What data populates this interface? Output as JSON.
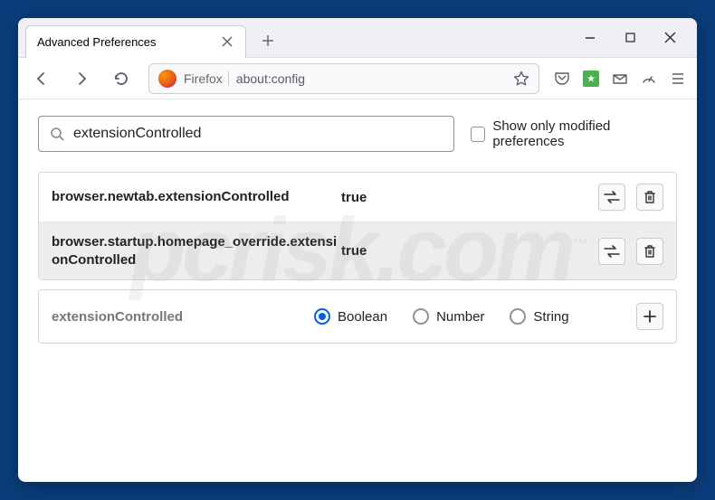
{
  "titlebar": {
    "tab_title": "Advanced Preferences"
  },
  "toolbar": {
    "identity_label": "Firefox",
    "url": "about:config"
  },
  "search": {
    "value": "extensionControlled",
    "show_modified_label": "Show only modified preferences"
  },
  "results": [
    {
      "name": "browser.newtab.extensionControlled",
      "value": "true",
      "striped": false
    },
    {
      "name": "browser.startup.homepage_override.extensionControlled",
      "value": "true",
      "striped": true
    }
  ],
  "add": {
    "name": "extensionControlled",
    "types": [
      {
        "label": "Boolean",
        "selected": true
      },
      {
        "label": "Number",
        "selected": false
      },
      {
        "label": "String",
        "selected": false
      }
    ]
  },
  "watermark": "pcrisk.com"
}
